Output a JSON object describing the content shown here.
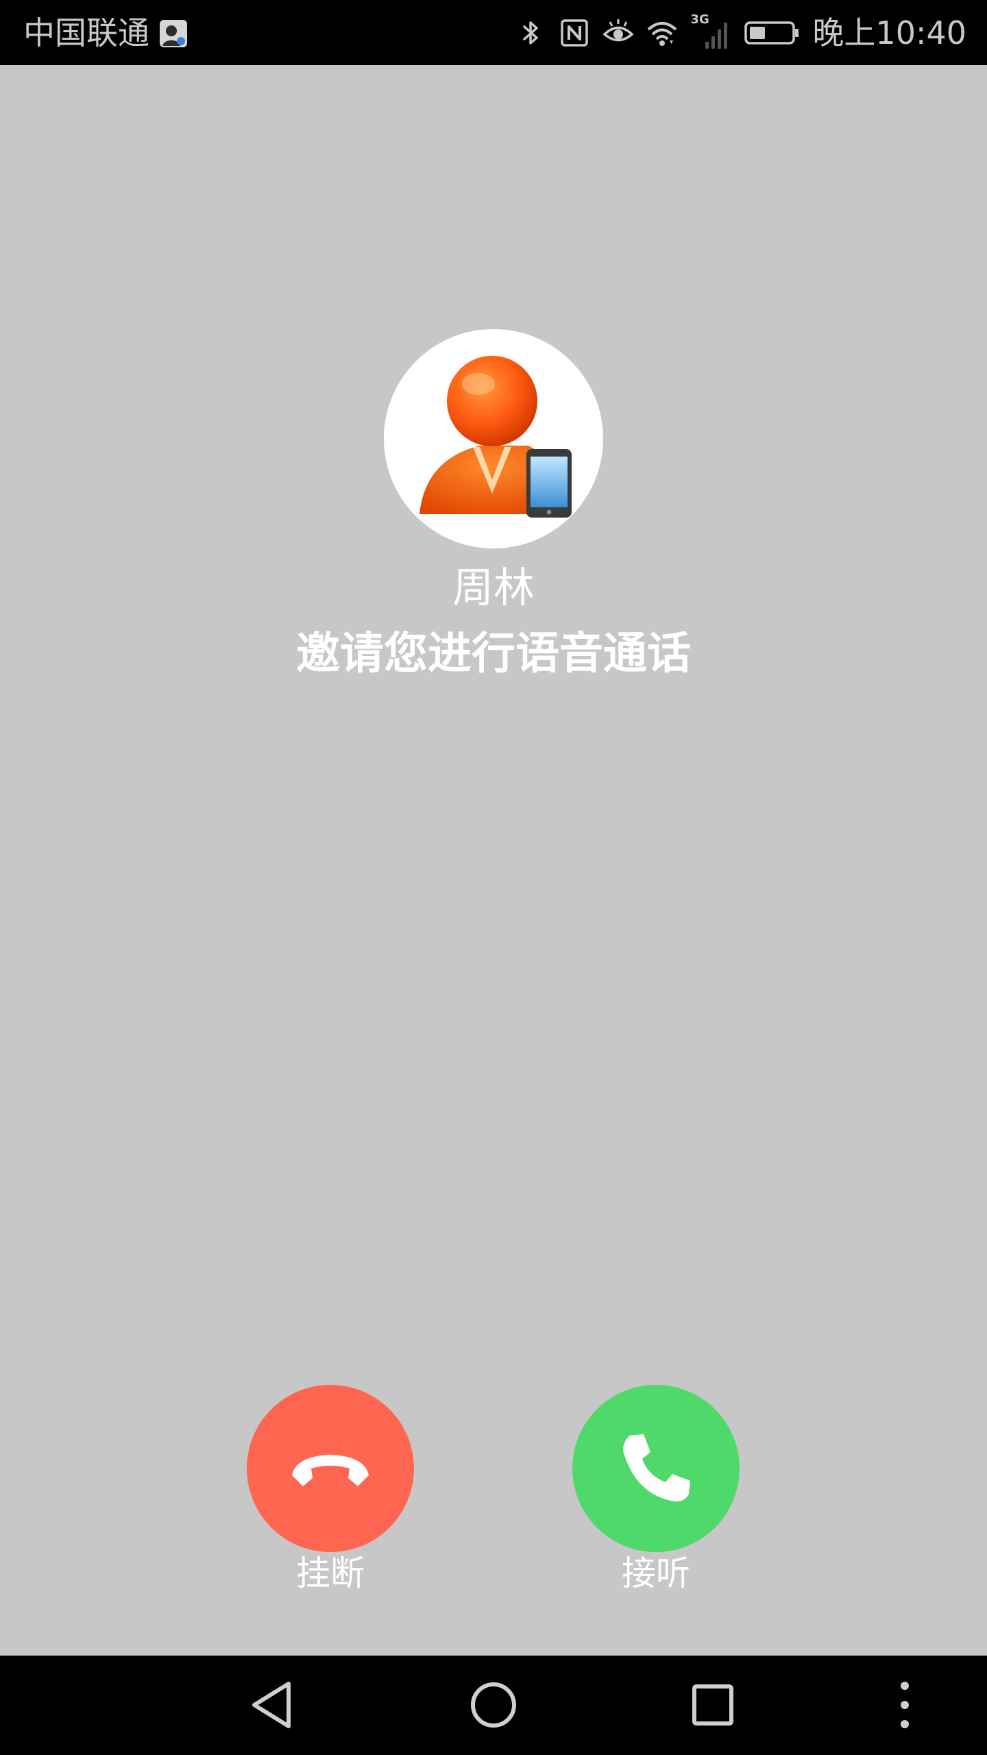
{
  "status_bar": {
    "carrier": "中国联通",
    "network": "3G",
    "clock": "晚上10:40",
    "icons": [
      "profile-icon",
      "bluetooth-icon",
      "nfc-icon",
      "eye-comfort-icon",
      "wifi-icon",
      "signal-icon",
      "battery-icon"
    ]
  },
  "caller": {
    "name": "周林",
    "invite_text": "邀请您进行语音通话",
    "avatar_icon": "mobile-contact-avatar"
  },
  "actions": {
    "hangup_label": "挂断",
    "answer_label": "接听",
    "hangup_color": "#ff6652",
    "answer_color": "#4fd96a"
  },
  "nav_bar": {
    "icons": [
      "back-icon",
      "home-icon",
      "recent-apps-icon",
      "more-icon"
    ]
  }
}
